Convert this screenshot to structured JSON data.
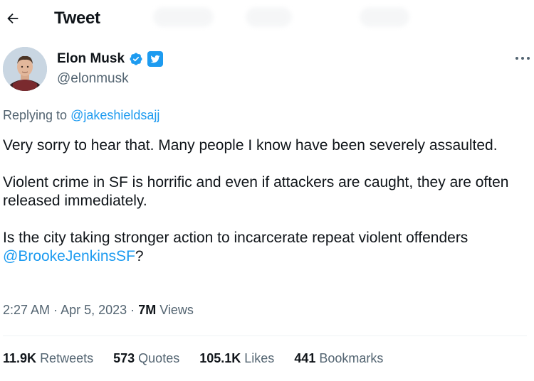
{
  "header": {
    "back_icon": "arrow-left-icon",
    "title": "Tweet"
  },
  "author": {
    "name": "Elon Musk",
    "handle": "@elonmusk",
    "verified_icon": "verified-badge-icon",
    "affiliate_icon": "twitter-bird-badge-icon"
  },
  "more_icon": "more-horizontal-icon",
  "replying": {
    "prefix": "Replying to",
    "handle": "@jakeshieldsajj"
  },
  "tweet": {
    "paragraph_1": "Very sorry to hear that. Many people I know have been severely assaulted.",
    "paragraph_2": "Violent crime in SF is horrific and even if attackers are caught, they are often released immediately.",
    "paragraph_3_text": "Is the city taking stronger action to incarcerate repeat violent offenders",
    "paragraph_3_mention": "@BrookeJenkinsSF",
    "paragraph_3_suffix": "?"
  },
  "meta": {
    "time": "2:27 AM",
    "separator": "·",
    "date": "Apr 5, 2023",
    "views_count": "7M",
    "views_label": "Views"
  },
  "stats": {
    "retweets_count": "11.9K",
    "retweets_label": "Retweets",
    "quotes_count": "573",
    "quotes_label": "Quotes",
    "likes_count": "105.1K",
    "likes_label": "Likes",
    "bookmarks_count": "441",
    "bookmarks_label": "Bookmarks"
  },
  "colors": {
    "link": "#1d9bf0",
    "text_primary": "#0f1419",
    "text_secondary": "#536471",
    "verified": "#1d9bf0"
  }
}
